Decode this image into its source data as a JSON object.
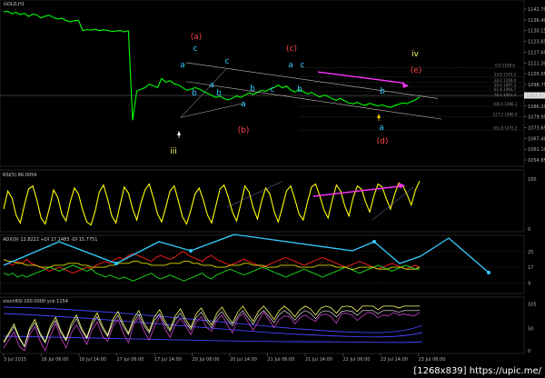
{
  "headers": {
    "main": "GOLD,H1",
    "rsi": "RSI(5) 86.0054",
    "adx": "ADX(9) 12.8222 +DI 17.1483 -DI 15.7751",
    "stoch": "stochRSI 100.0000 ycb 1154"
  },
  "watermark": "[1268x839] https://upic.me/",
  "colors": {
    "price": "#00ff00",
    "rsi": "#ffff00",
    "wave_red": "#ff4444",
    "wave_cyan": "#33ccff",
    "wave_yellow": "#ffff66",
    "magenta": "#ff33ff",
    "adx_cyan": "#33ccff"
  },
  "chart_data": [
    {
      "type": "line",
      "panel": "main",
      "x_ticks": [
        "3 Jul 2015",
        "16 Jul 06:00",
        "16 Jul 14:00",
        "17 Jul 06:00",
        "17 Jul 14:00",
        "20 Jul 06:00",
        "20 Jul 14:00",
        "21 Jul 06:00",
        "21 Jul 14:00",
        "22 Jul 06:00",
        "22 Jul 14:00",
        "23 Jul 06:00"
      ],
      "y_ticks": [
        "1142.70",
        "1136.40",
        "1130.15",
        "1123.85",
        "1117.60",
        "1111.30",
        "1105.05",
        "1098.75",
        "1092.50",
        "1086.20",
        "1079.95",
        "1073.65",
        "1067.40",
        "1061.10",
        "1054.85"
      ],
      "ylim": [
        1054.85,
        1142.7
      ],
      "price": [
        1141,
        1141.5,
        1140,
        1140.8,
        1139.5,
        1140.2,
        1138.4,
        1139.8,
        1139.2,
        1137.5,
        1138.6,
        1139.1,
        1137.8,
        1136.9,
        1137.4,
        1136,
        1135.4,
        1135.9,
        1136.2,
        1130.2,
        1130.8,
        1130.4,
        1131,
        1130.1,
        1130.6,
        1130.3,
        1129.7,
        1129.9,
        1130.2,
        1129.5,
        1130,
        1078,
        1095,
        1096,
        1097,
        1099,
        1098,
        1097,
        1102.3,
        1100.1,
        1101,
        1099.2,
        1098.5,
        1097.1,
        1095.4,
        1096.1,
        1097,
        1096.2,
        1094.8,
        1093.6,
        1092.4,
        1091.2,
        1092,
        1090.5,
        1089.8,
        1090.9,
        1092.1,
        1091.2,
        1092.6,
        1093.9,
        1093,
        1094.2,
        1095.4,
        1094.8,
        1096.2,
        1097,
        1098.4,
        1096.8,
        1097.9,
        1095.6,
        1094.4,
        1095.8,
        1094.6,
        1093.3,
        1094.1,
        1092.8,
        1091.5,
        1092.6,
        1091.9,
        1090.4,
        1089.6,
        1090.7,
        1089.2,
        1088.1,
        1087.5,
        1088.4,
        1087.2,
        1086.7,
        1087.8,
        1087,
        1086.3,
        1086.9,
        1086,
        1085.4,
        1086.5,
        1087.3,
        1088.1,
        1087.6,
        1088.9,
        1089.8,
        1091.5
      ],
      "current_price": "1092.41",
      "fib_levels": [
        "0.0 1108.6",
        "23.6 1103.3",
        "38.2 1100.0",
        "50.0 1097.3",
        "61.8 1094.7",
        "76.4 1091.4",
        "100.0 1086.1",
        "127.2 1080.0",
        "161.8 1072.2"
      ],
      "wave_labels": {
        "red": [
          "(a)",
          "(b)",
          "(c)",
          "(d)",
          "(e)"
        ],
        "cyan": [
          "a",
          "b",
          "c",
          "a",
          "b",
          "c",
          "a",
          "b",
          "c",
          "a",
          "b",
          "c",
          "b",
          "a"
        ],
        "yellow": [
          "iv",
          "iii"
        ]
      }
    },
    {
      "type": "line",
      "panel": "rsi",
      "y_ticks": [
        "100",
        "0"
      ],
      "ylim": [
        0,
        100
      ],
      "values": [
        40,
        76,
        62,
        28,
        12,
        48,
        80,
        86,
        58,
        22,
        10,
        42,
        78,
        64,
        30,
        16,
        54,
        82,
        70,
        38,
        14,
        8,
        36,
        74,
        88,
        60,
        26,
        12,
        48,
        84,
        72,
        40,
        18,
        52,
        78,
        90,
        62,
        30,
        14,
        44,
        76,
        86,
        56,
        24,
        10,
        38,
        70,
        82,
        58,
        28,
        12,
        46,
        80,
        88,
        64,
        34,
        16,
        50,
        86,
        74,
        42,
        20,
        56,
        82,
        70,
        36,
        14,
        44,
        76,
        86,
        60,
        30,
        18,
        52,
        84,
        90,
        66,
        38,
        22,
        58,
        88,
        76,
        46,
        26,
        62,
        86,
        80,
        54,
        34,
        66,
        90,
        84,
        60,
        40,
        70,
        92,
        86,
        68,
        48,
        78,
        96
      ]
    },
    {
      "type": "line",
      "panel": "adx",
      "y_ticks": [
        "25",
        "17",
        "9"
      ],
      "ylim": [
        5,
        30
      ],
      "series": [
        {
          "name": "+DI",
          "color": "#ff2020",
          "values": [
            18,
            19,
            18,
            20,
            19,
            21,
            19,
            18,
            17,
            16,
            15,
            16,
            17,
            16,
            15,
            14,
            15,
            16,
            17,
            16,
            18,
            19,
            20,
            19,
            21,
            22,
            21,
            23,
            24,
            23,
            22,
            21,
            20,
            22,
            23,
            22,
            21,
            22,
            24,
            25,
            23,
            22,
            21,
            20,
            22,
            23,
            21,
            20,
            19,
            18,
            19,
            20,
            21,
            20,
            19,
            18,
            17,
            18,
            19,
            20,
            21,
            22,
            21,
            20,
            19,
            18,
            19,
            20,
            21,
            22,
            21,
            20,
            19,
            18,
            17,
            18,
            19,
            20,
            19,
            18,
            17,
            16,
            17,
            18,
            19,
            18,
            17,
            16,
            17,
            18,
            17
          ]
        },
        {
          "name": "-DI",
          "color": "#20dd20",
          "values": [
            14,
            13,
            14,
            12,
            13,
            12,
            13,
            14,
            15,
            16,
            17,
            16,
            15,
            16,
            17,
            18,
            17,
            16,
            15,
            16,
            14,
            13,
            12,
            13,
            12,
            11,
            12,
            11,
            10,
            11,
            12,
            13,
            14,
            12,
            11,
            12,
            13,
            12,
            11,
            10,
            11,
            12,
            13,
            14,
            12,
            11,
            13,
            14,
            15,
            16,
            15,
            14,
            13,
            14,
            15,
            16,
            17,
            16,
            15,
            14,
            13,
            12,
            13,
            14,
            15,
            16,
            15,
            14,
            13,
            12,
            13,
            14,
            15,
            16,
            17,
            16,
            15,
            14,
            15,
            16,
            17,
            18,
            17,
            16,
            15,
            16,
            17,
            18,
            17,
            16,
            16
          ]
        },
        {
          "name": "ADX",
          "color": "#dddd00",
          "values": [
            21,
            20,
            20,
            19,
            19,
            18,
            18,
            18,
            17,
            17,
            17,
            18,
            18,
            18,
            19,
            19,
            19,
            18,
            18,
            17,
            17,
            17,
            17,
            18,
            18,
            19,
            19,
            19,
            20,
            20,
            19,
            19,
            18,
            18,
            18,
            18,
            19,
            19,
            19,
            20,
            20,
            19,
            19,
            18,
            18,
            18,
            17,
            17,
            17,
            18,
            18,
            18,
            19,
            19,
            18,
            18,
            18,
            17,
            17,
            17,
            18,
            18,
            18,
            18,
            17,
            17,
            17,
            17,
            18,
            18,
            18,
            18,
            17,
            17,
            17,
            16,
            16,
            17,
            17,
            17,
            17,
            16,
            16,
            16,
            17,
            17,
            17,
            16,
            16,
            16,
            17
          ]
        }
      ]
    },
    {
      "type": "line",
      "panel": "stochRSI",
      "y_ticks": [
        "105",
        "50",
        "0"
      ],
      "ylim": [
        0,
        110
      ],
      "values": [
        20,
        40,
        60,
        30,
        10,
        50,
        70,
        40,
        20,
        55,
        75,
        45,
        25,
        60,
        80,
        50,
        30,
        65,
        85,
        55,
        35,
        70,
        88,
        60,
        40,
        72,
        90,
        62,
        44,
        76,
        92,
        66,
        48,
        78,
        94,
        70,
        52,
        82,
        96,
        74,
        58,
        84,
        98,
        78,
        62,
        86,
        100,
        82,
        66,
        88,
        100,
        86,
        70,
        90,
        100,
        90,
        76,
        92,
        100,
        94,
        80,
        96,
        100,
        96,
        84,
        98,
        100,
        98,
        88,
        100,
        100,
        100,
        92,
        100,
        100,
        100,
        96,
        100,
        100,
        100,
        100
      ]
    }
  ]
}
